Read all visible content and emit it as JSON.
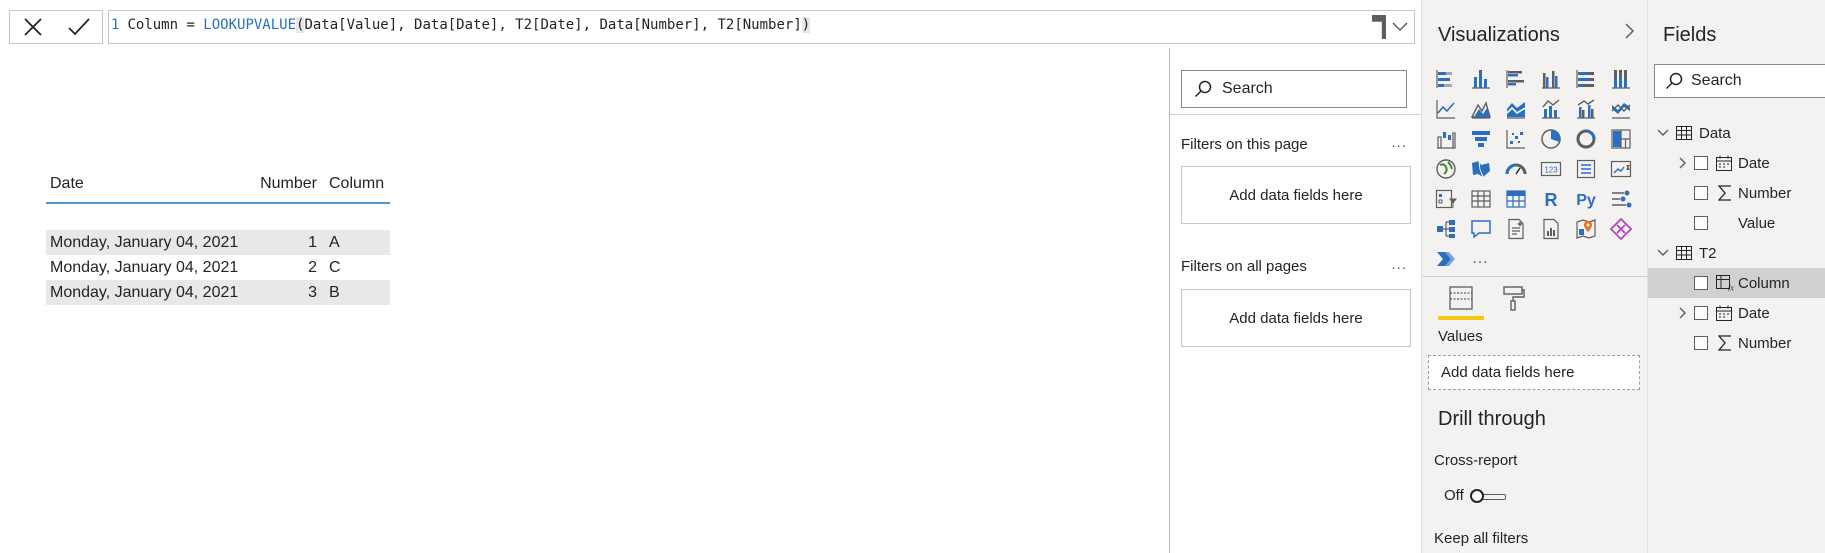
{
  "formula": {
    "line_number": "1",
    "prefix": "Column = ",
    "function": "LOOKUPVALUE",
    "open_paren": "(",
    "args": "Data[Value], Data[Date], T2[Date], Data[Number], T2[Number]",
    "close_paren": ")"
  },
  "table": {
    "headers": [
      "Date",
      "Number",
      "Column"
    ],
    "rows": [
      {
        "date": "Monday, January 04, 2021",
        "number": "1",
        "column": "A"
      },
      {
        "date": "Monday, January 04, 2021",
        "number": "2",
        "column": "C"
      },
      {
        "date": "Monday, January 04, 2021",
        "number": "3",
        "column": "B"
      }
    ]
  },
  "filters": {
    "search_placeholder": "Search",
    "this_page_title": "Filters on this page",
    "all_pages_title": "Filters on all pages",
    "more": "...",
    "drop_text": "Add data fields here"
  },
  "visualizations": {
    "title": "Visualizations",
    "more": "...",
    "values_label": "Values",
    "values_drop": "Add data fields here",
    "drill_title": "Drill through",
    "cross_report": "Cross-report",
    "toggle_state": "Off",
    "keep_filters": "Keep all filters",
    "accent": "#f2c811"
  },
  "fields": {
    "title": "Fields",
    "search_placeholder": "Search",
    "tables": [
      {
        "name": "Data",
        "fields": [
          "Date",
          "Number",
          "Value"
        ]
      },
      {
        "name": "T2",
        "fields": [
          "Column",
          "Date",
          "Number"
        ]
      }
    ]
  }
}
